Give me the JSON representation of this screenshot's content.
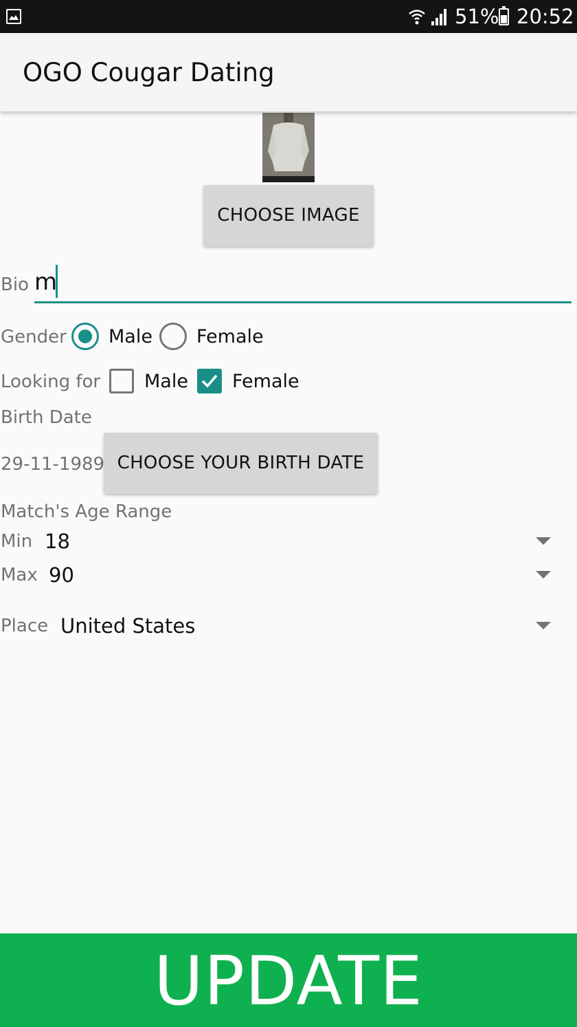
{
  "status_bar": {
    "battery": "51%",
    "time": "20:52",
    "icons": [
      "image-notification-icon",
      "wifi-icon",
      "signal-icon",
      "battery-icon"
    ]
  },
  "app_bar": {
    "title": "OGO Cougar Dating"
  },
  "profile": {
    "choose_image_label": "CHOOSE IMAGE",
    "bio_label": "Bio",
    "bio_value": "m",
    "gender_label": "Gender",
    "gender_options": [
      "Male",
      "Female"
    ],
    "gender_selected": "Male",
    "looking_for_label": "Looking for",
    "looking_for_options": [
      {
        "label": "Male",
        "checked": false
      },
      {
        "label": "Female",
        "checked": true
      }
    ],
    "birth_date_label": "Birth Date",
    "birth_date_value": "29-11-1989",
    "choose_birth_date_label": "CHOOSE YOUR BIRTH DATE",
    "age_range_label": "Match's Age Range",
    "min_label": "Min",
    "min_value": "18",
    "max_label": "Max",
    "max_value": "90",
    "place_label": "Place",
    "place_value": "United States"
  },
  "update_label": "UPDATE",
  "colors": {
    "accent": "#1a8f87",
    "update_button": "#0fb04f",
    "status_bar": "#141414",
    "app_bar": "#f5f5f5",
    "background": "#fafafa"
  }
}
